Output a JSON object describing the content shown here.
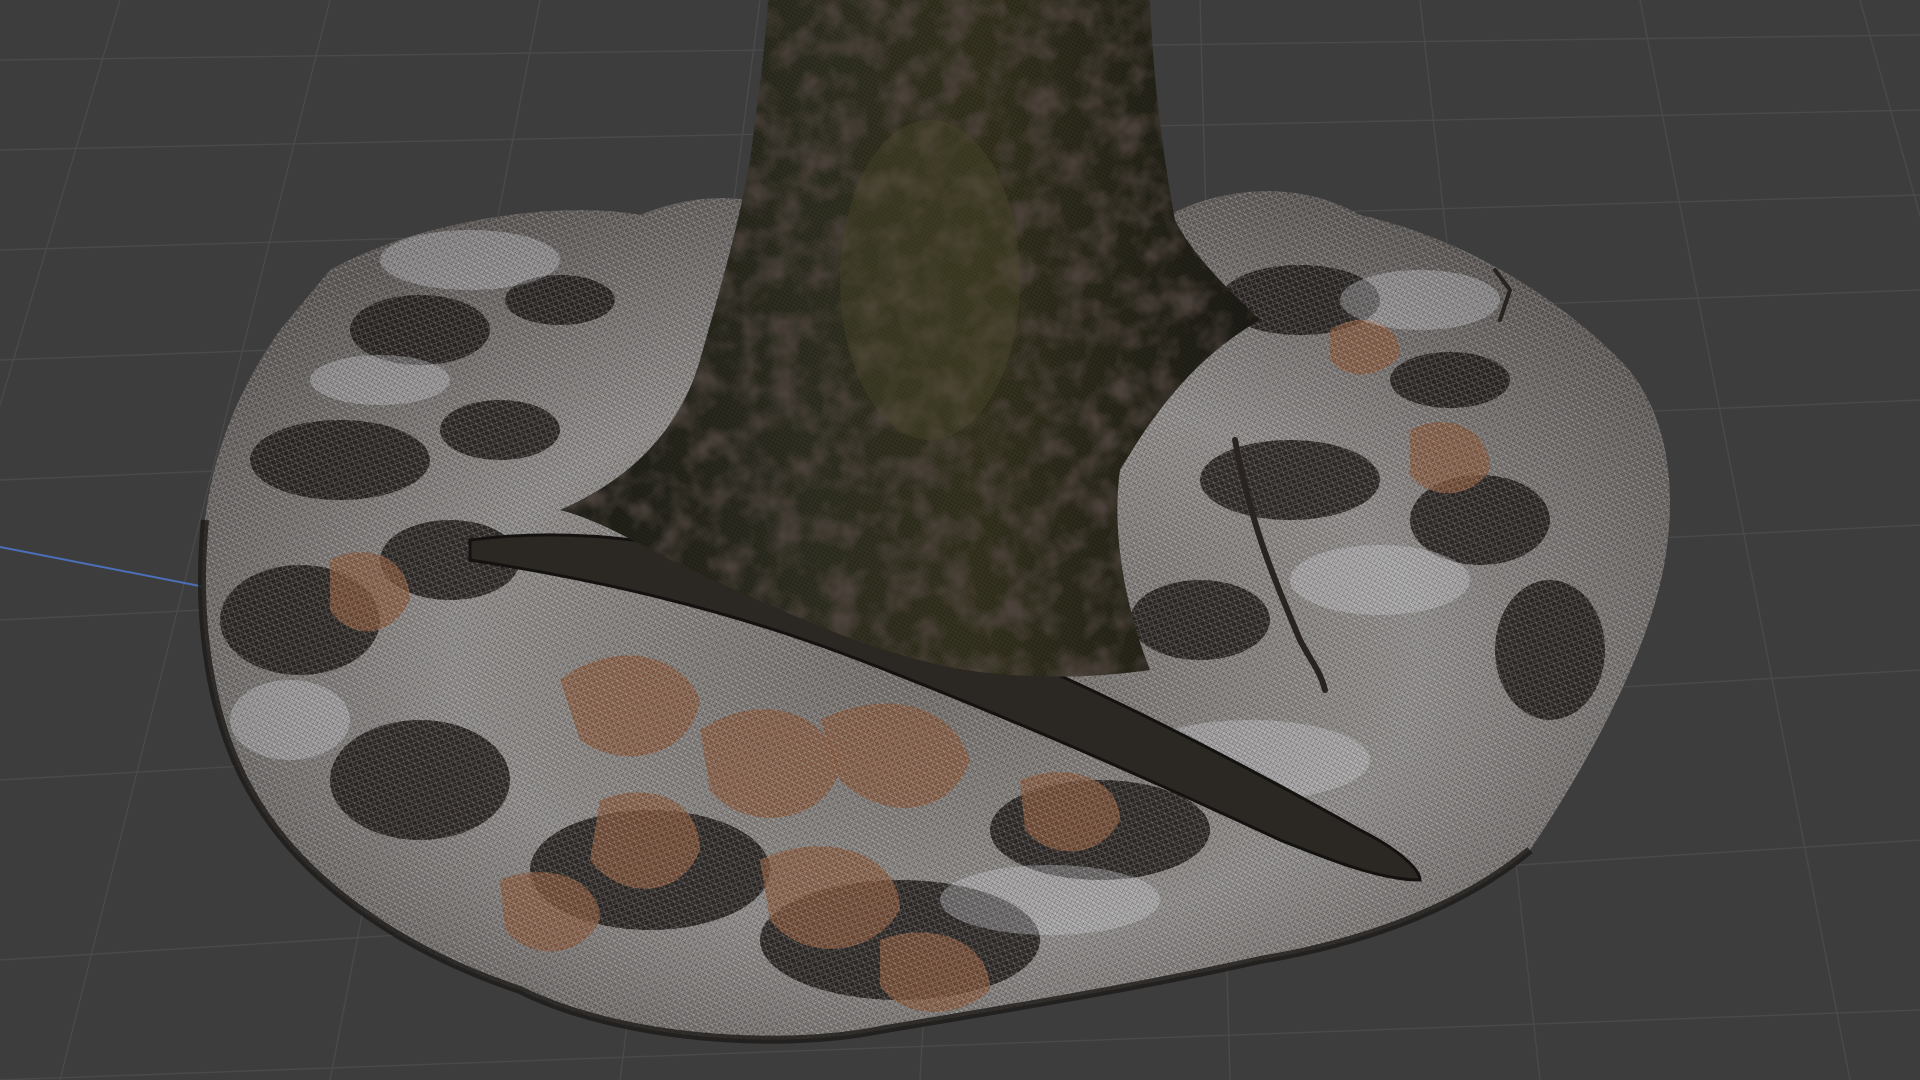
{
  "viewport": {
    "kind": "3d-viewport",
    "subject": "tree-trunk-scan-mesh",
    "display_mode": "textured-wireframe",
    "colors": {
      "background": "#3d3d3d",
      "grid_line": "#4a4a4a",
      "axis_x": "#4b6fb8",
      "ground_light": "#c9c9cc",
      "ground_dark": "#1c1816",
      "leaf_brown": "#8a5a3e",
      "trunk": "#2a2a1e"
    }
  }
}
